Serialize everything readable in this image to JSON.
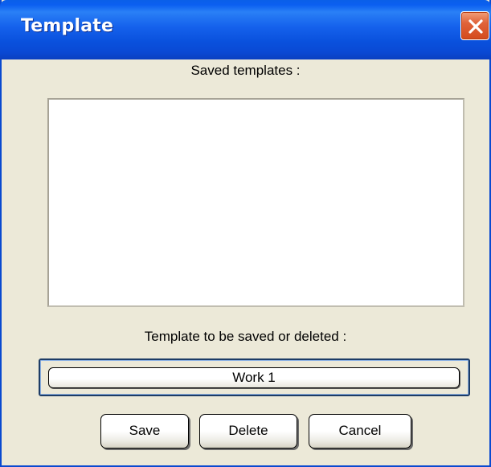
{
  "window": {
    "title": "Template",
    "title_bar_color": "#0a51dd",
    "close_button_color": "#d44a1c"
  },
  "saved_templates": {
    "label": "Saved templates :",
    "items": []
  },
  "template_name": {
    "label": "Template to be saved or deleted :",
    "value": "Work 1"
  },
  "buttons": {
    "save": "Save",
    "delete": "Delete",
    "cancel": "Cancel"
  },
  "icons": {
    "close": "close-icon"
  }
}
